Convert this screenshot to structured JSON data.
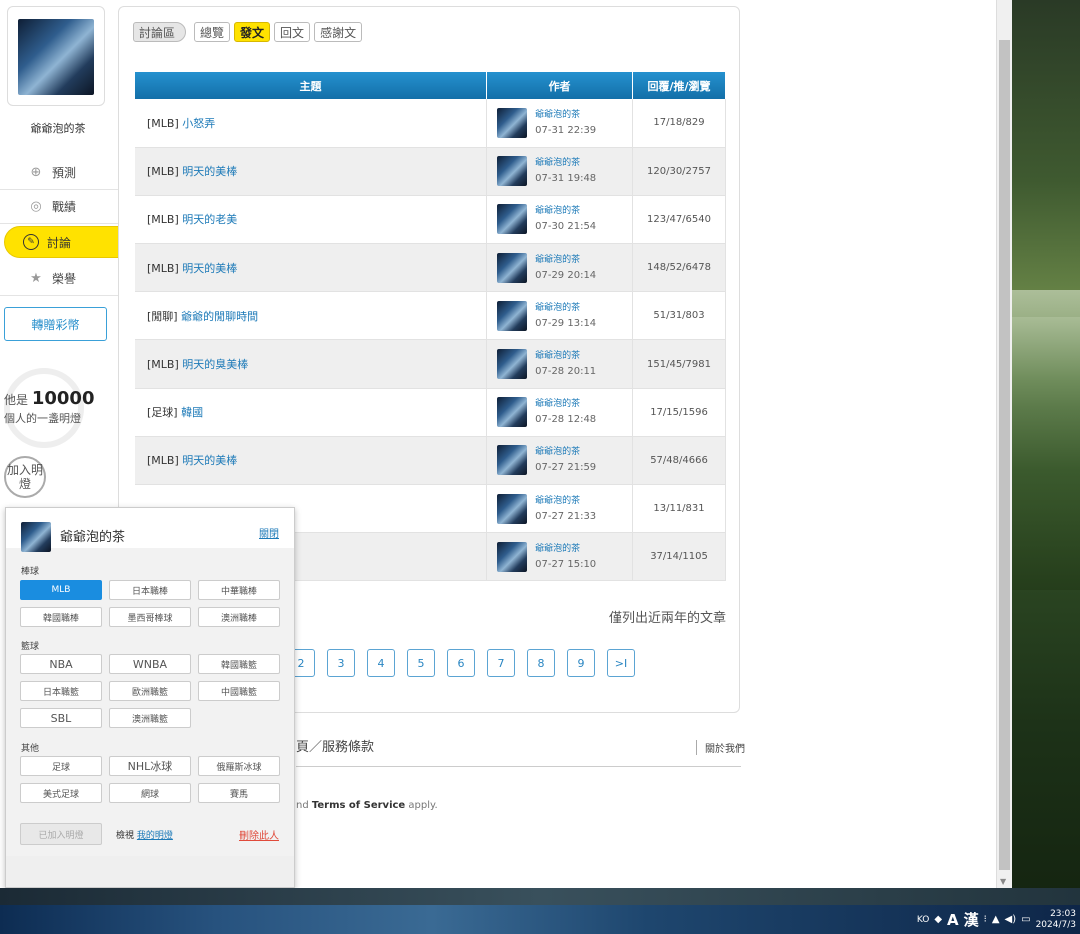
{
  "user": {
    "name": "爺爺泡的茶"
  },
  "sidebar": {
    "items": [
      {
        "label": "預測",
        "icon": "target-icon"
      },
      {
        "label": "戰績",
        "icon": "chat-icon"
      },
      {
        "label": "討論",
        "icon": "discuss-icon"
      },
      {
        "label": "榮譽",
        "icon": "medal-icon"
      }
    ],
    "gift_button": "轉贈彩幣",
    "lamp_prefix": "他是",
    "lamp_count": "10000",
    "lamp_suffix": "個人的一盞明燈",
    "join_lamp": "加入明燈"
  },
  "tabs": [
    "討論區",
    "總覽",
    "發文",
    "回文",
    "感謝文"
  ],
  "table": {
    "headers": [
      "主題",
      "作者",
      "回覆/推/瀏覽"
    ],
    "rows": [
      {
        "prefix": "[MLB]",
        "topic": "小怒弄",
        "author": "爺爺泡的茶",
        "date": "07-31 22:39",
        "stats": "17/18/829"
      },
      {
        "prefix": "[MLB]",
        "topic": "明天的美棒",
        "author": "爺爺泡的茶",
        "date": "07-31 19:48",
        "stats": "120/30/2757"
      },
      {
        "prefix": "[MLB]",
        "topic": "明天的老美",
        "author": "爺爺泡的茶",
        "date": "07-30 21:54",
        "stats": "123/47/6540"
      },
      {
        "prefix": "[MLB]",
        "topic": "明天的美棒",
        "author": "爺爺泡的茶",
        "date": "07-29 20:14",
        "stats": "148/52/6478"
      },
      {
        "prefix": "[閒聊]",
        "topic": "爺爺的閒聊時間",
        "author": "爺爺泡的茶",
        "date": "07-29 13:14",
        "stats": "51/31/803"
      },
      {
        "prefix": "[MLB]",
        "topic": "明天的臭美棒",
        "author": "爺爺泡的茶",
        "date": "07-28 20:11",
        "stats": "151/45/7981"
      },
      {
        "prefix": "[足球]",
        "topic": "韓國",
        "author": "爺爺泡的茶",
        "date": "07-28 12:48",
        "stats": "17/15/1596"
      },
      {
        "prefix": "[MLB]",
        "topic": "明天的美棒",
        "author": "爺爺泡的茶",
        "date": "07-27 21:59",
        "stats": "57/48/4666"
      },
      {
        "prefix": "",
        "topic": "",
        "author": "爺爺泡的茶",
        "date": "07-27 21:33",
        "stats": "13/11/831"
      },
      {
        "prefix": "",
        "topic": "",
        "author": "爺爺泡的茶",
        "date": "07-27 15:10",
        "stats": "37/14/1105"
      }
    ]
  },
  "two_year_note": "僅列出近兩年的文章",
  "pager": [
    "2",
    "3",
    "4",
    "5",
    "6",
    "7",
    "8",
    "9",
    ">I"
  ],
  "footer": {
    "links": "頁／服務條款",
    "about": "關於我們",
    "recaptcha_prefix": "nd",
    "recaptcha_tos": "Terms of Service",
    "recaptcha_suffix": "apply."
  },
  "popup": {
    "name": "爺爺泡的茶",
    "close": "關閉",
    "categories": [
      {
        "label": "棒球",
        "options": [
          "MLB",
          "日本職棒",
          "中華職棒",
          "韓國職棒",
          "墨西哥棒球",
          "澳洲職棒"
        ]
      },
      {
        "label": "籃球",
        "options": [
          "NBA",
          "WNBA",
          "韓國職籃",
          "日本職籃",
          "歐洲職籃",
          "中國職籃",
          "SBL",
          "澳洲職籃"
        ]
      },
      {
        "label": "其他",
        "options": [
          "足球",
          "NHL冰球",
          "俄羅斯冰球",
          "美式足球",
          "網球",
          "賽馬"
        ]
      }
    ],
    "selected": "MLB",
    "joined_btn": "已加入明燈",
    "view_prefix": "檢視",
    "view_link": "我的明燈",
    "remove": "刪除此人"
  },
  "taskbar": {
    "ime_lang": "KO",
    "ime_a": "A",
    "ime_han": "漢",
    "time": "23:03",
    "date": "2024/7/3"
  }
}
